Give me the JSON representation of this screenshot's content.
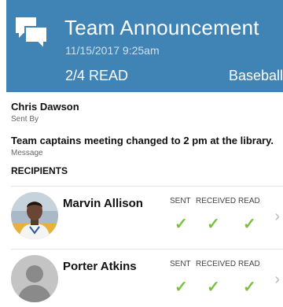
{
  "header": {
    "title": "Team Announcement",
    "date": "11/15/2017 9:25am",
    "read_status": "2/4 READ",
    "team": "Baseball",
    "background": "#3f84b4",
    "icon": "chat-bubbles-icon"
  },
  "sender": {
    "name": "Chris Dawson",
    "label": "Sent By"
  },
  "message": {
    "text": "Team captains meeting changed to 2 pm at the library.",
    "label": "Message"
  },
  "recipients_heading": "RECIPIENTS",
  "status_labels": {
    "sent": "SENT",
    "received": "RECEIVED",
    "read": "READ"
  },
  "recipients": [
    {
      "name": "Marvin Allison",
      "avatar": "photo",
      "sent": true,
      "received": true,
      "read": true
    },
    {
      "name": "Porter Atkins",
      "avatar": "placeholder-silhouette",
      "sent": true,
      "received": true,
      "read": true
    }
  ],
  "colors": {
    "check": "#7ac143"
  }
}
